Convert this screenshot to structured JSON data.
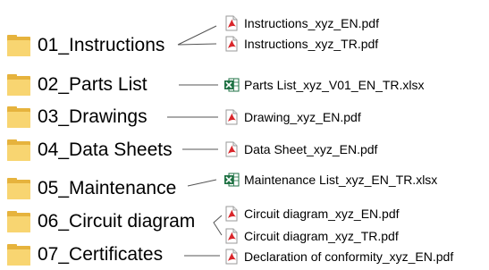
{
  "folders": [
    {
      "label": "01_Instructions"
    },
    {
      "label": "02_Parts List"
    },
    {
      "label": "03_Drawings"
    },
    {
      "label": "04_Data Sheets"
    },
    {
      "label": "05_Maintenance"
    },
    {
      "label": "06_Circuit diagram"
    },
    {
      "label": "07_Certificates"
    }
  ],
  "files": [
    {
      "name": "Instructions_xyz_EN.pdf",
      "icon": "pdf-icon"
    },
    {
      "name": "Instructions_xyz_TR.pdf",
      "icon": "pdf-icon"
    },
    {
      "name": "Parts List_xyz_V01_EN_TR.xlsx",
      "icon": "excel-icon"
    },
    {
      "name": "Drawing_xyz_EN.pdf",
      "icon": "pdf-icon"
    },
    {
      "name": "Data Sheet_xyz_EN.pdf",
      "icon": "pdf-icon"
    },
    {
      "name": "Maintenance List_xyz_EN_TR.xlsx",
      "icon": "excel-icon"
    },
    {
      "name": "Circuit diagram_xyz_EN.pdf",
      "icon": "pdf-icon"
    },
    {
      "name": "Circuit diagram_xyz_TR.pdf",
      "icon": "pdf-icon"
    },
    {
      "name": "Declaration of conformity_xyz_EN.pdf",
      "icon": "pdf-icon"
    }
  ],
  "colors": {
    "folder_front": "#f8d571",
    "folder_back": "#e6b33d",
    "pdf_red": "#d9262b",
    "excel_green": "#1f7244",
    "connector": "#555555"
  }
}
